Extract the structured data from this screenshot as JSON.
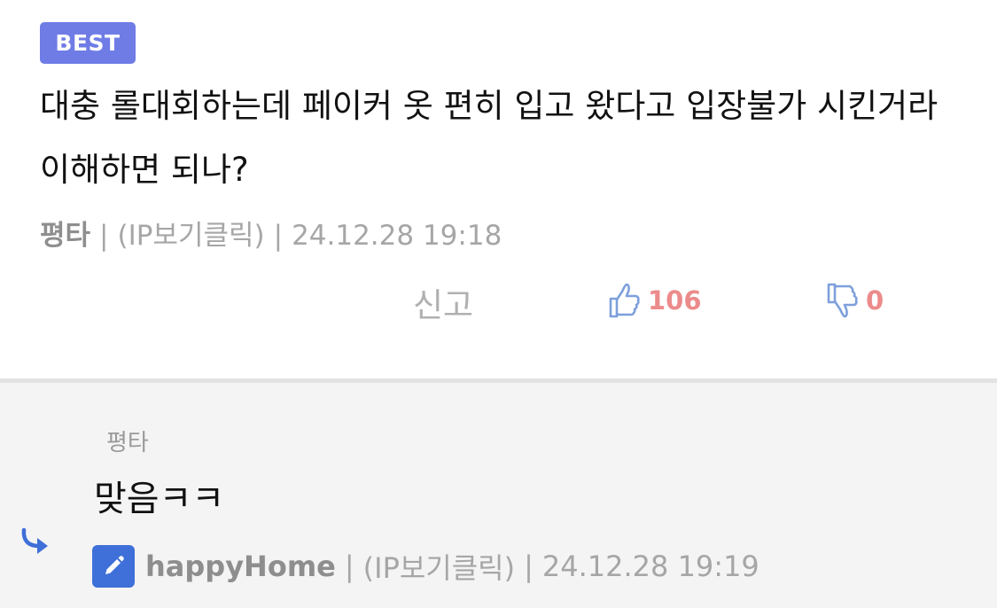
{
  "comment": {
    "badge": "BEST",
    "text": "대충 롤대회하는데 페이커 옷 편히 입고 왔다고 입장불가 시킨거라 이해하면 되나?",
    "author": "평타",
    "ip": "(IP보기클릭)",
    "timestamp": "24.12.28 19:18",
    "report_label": "신고",
    "likes": "106",
    "dislikes": "0",
    "separator": "|",
    "icons": {
      "like": "thumbs-up-icon",
      "dislike": "thumbs-down-icon"
    }
  },
  "reply": {
    "parent_author": "평타",
    "text": "맞음ㅋㅋ",
    "author": "happyHome",
    "ip": "(IP보기클릭)",
    "timestamp": "24.12.28 19:19",
    "separator": "|",
    "icons": {
      "reply": "reply-arrow-icon",
      "author_badge": "pencil-icon"
    }
  },
  "colors": {
    "badge": "#6f7ce6",
    "vote_count": "#ec8b8b",
    "icon_blue": "#7ea0dc",
    "pencil_badge": "#3f6fd8",
    "reply_bg": "#f4f4f4"
  }
}
